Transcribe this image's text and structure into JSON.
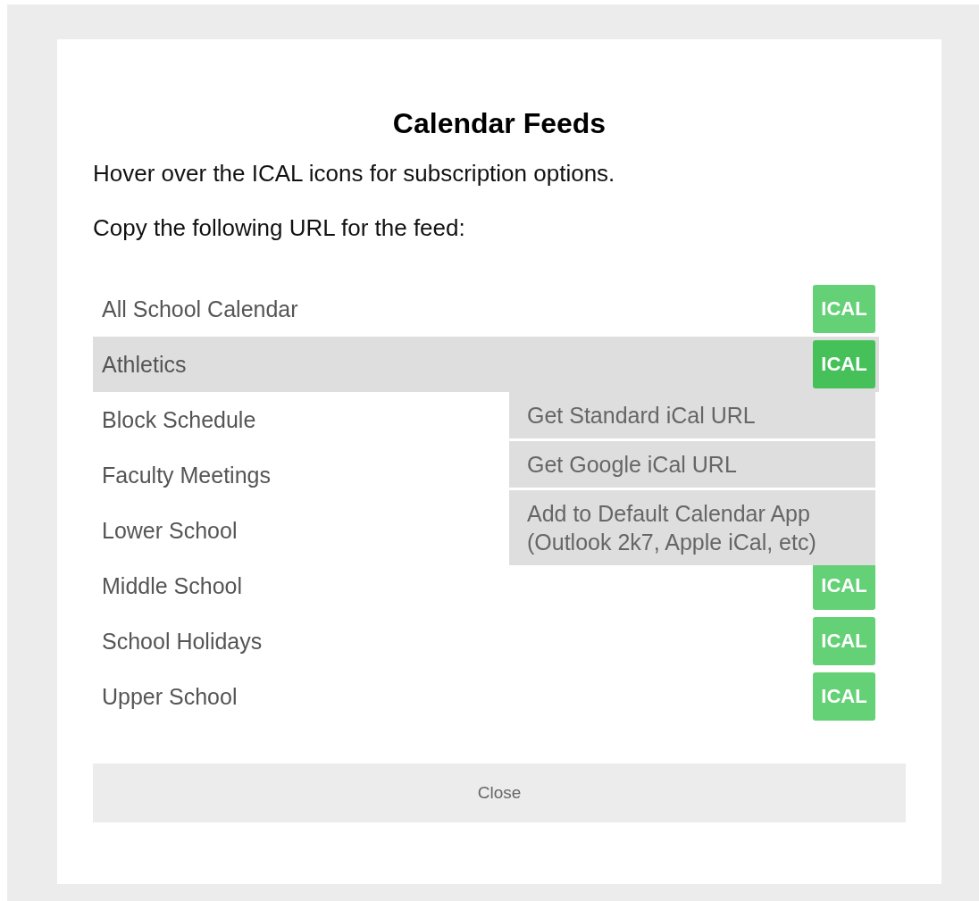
{
  "dialog": {
    "title": "Calendar Feeds",
    "instructions": [
      "Hover over the ICAL icons for subscription options.",
      "Copy the following URL for the feed:"
    ]
  },
  "feeds": [
    {
      "name": "All School Calendar",
      "badge": "ICAL",
      "selected": false
    },
    {
      "name": "Athletics",
      "badge": "ICAL",
      "selected": true
    },
    {
      "name": "Block Schedule",
      "selected": false
    },
    {
      "name": "Faculty Meetings",
      "selected": false
    },
    {
      "name": "Lower School",
      "selected": false
    },
    {
      "name": "Middle School",
      "badge": "ICAL",
      "selected": false
    },
    {
      "name": "School Holidays",
      "badge": "ICAL",
      "selected": false
    },
    {
      "name": "Upper School",
      "badge": "ICAL",
      "selected": false
    }
  ],
  "popup_menu": [
    {
      "lines": [
        "Get Standard iCal URL"
      ]
    },
    {
      "lines": [
        "Get Google iCal URL"
      ]
    },
    {
      "lines": [
        "Add to Default Calendar App",
        "(Outlook 2k7, Apple iCal, etc)"
      ]
    }
  ],
  "close_button": "Close"
}
